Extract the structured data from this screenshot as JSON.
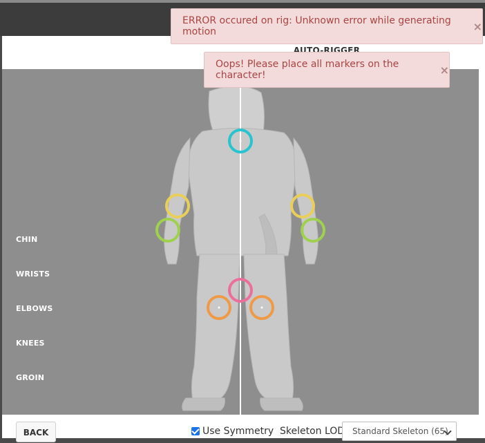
{
  "modal": {
    "title": "AUTO-RIGGER"
  },
  "markers": {
    "labels": [
      "CHIN",
      "WRISTS",
      "ELBOWS",
      "KNEES",
      "GROIN"
    ],
    "colors": {
      "chin": "#27c3cf",
      "elbows": "#e9cf5a",
      "wrists": "#9fd14e",
      "groin": "#ec6f9b",
      "knees": "#ef9a47"
    }
  },
  "footer": {
    "back_label": "BACK",
    "symmetry_label": "Use Symmetry",
    "symmetry_checked": true,
    "lod_label": "Skeleton LOD",
    "lod_value": "Standard Skeleton (65)"
  },
  "toasts": [
    {
      "message": "ERROR occured on rig: Unknown error while generating motion",
      "close": "×"
    },
    {
      "message": "Oops! Please place all markers on the character!",
      "close": "×"
    }
  ],
  "colors": {
    "error_bg": "#f3dbdb",
    "error_text": "#a94442",
    "viewport_bg": "#8e8e8e"
  }
}
